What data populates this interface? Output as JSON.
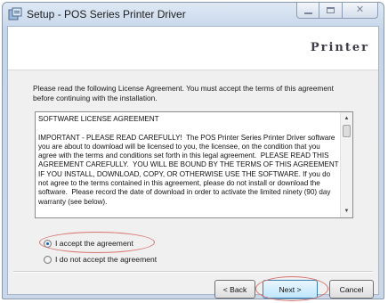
{
  "window": {
    "title": "Setup - POS Series Printer Driver",
    "controls": [
      "minimize",
      "maximize",
      "close"
    ]
  },
  "header": {
    "brand": "Printer"
  },
  "intro": "Please read the following License Agreement. You must accept the terms of this agreement before continuing with the installation.",
  "license": {
    "text": "SOFTWARE LICENSE AGREEMENT\n\nIMPORTANT - PLEASE READ CAREFULLY!  The POS Printer Series Printer Driver software you are about to download will be licensed to you, the licensee, on the condition that you agree with the terms and conditions set forth in this legal agreement.  PLEASE READ THIS AGREEMENT CAREFULLY.  YOU WILL BE BOUND BY THE TERMS OF THIS AGREEMENT IF YOU INSTALL, DOWNLOAD, COPY, OR OTHERWISE USE THE SOFTWARE. If you do not agree to the terms contained in this agreement, please do not install or download the software.  Please record the date of download in order to activate the limited ninety (90) day warranty (see below)."
  },
  "options": {
    "accept": "I accept the agreement",
    "decline": "I do not accept the agreement",
    "selected": "accept"
  },
  "buttons": {
    "back": "< Back",
    "next": "Next >",
    "cancel": "Cancel"
  },
  "colors": {
    "highlight_ellipse": "#d9736f",
    "default_button_border": "#3c7fb1"
  }
}
